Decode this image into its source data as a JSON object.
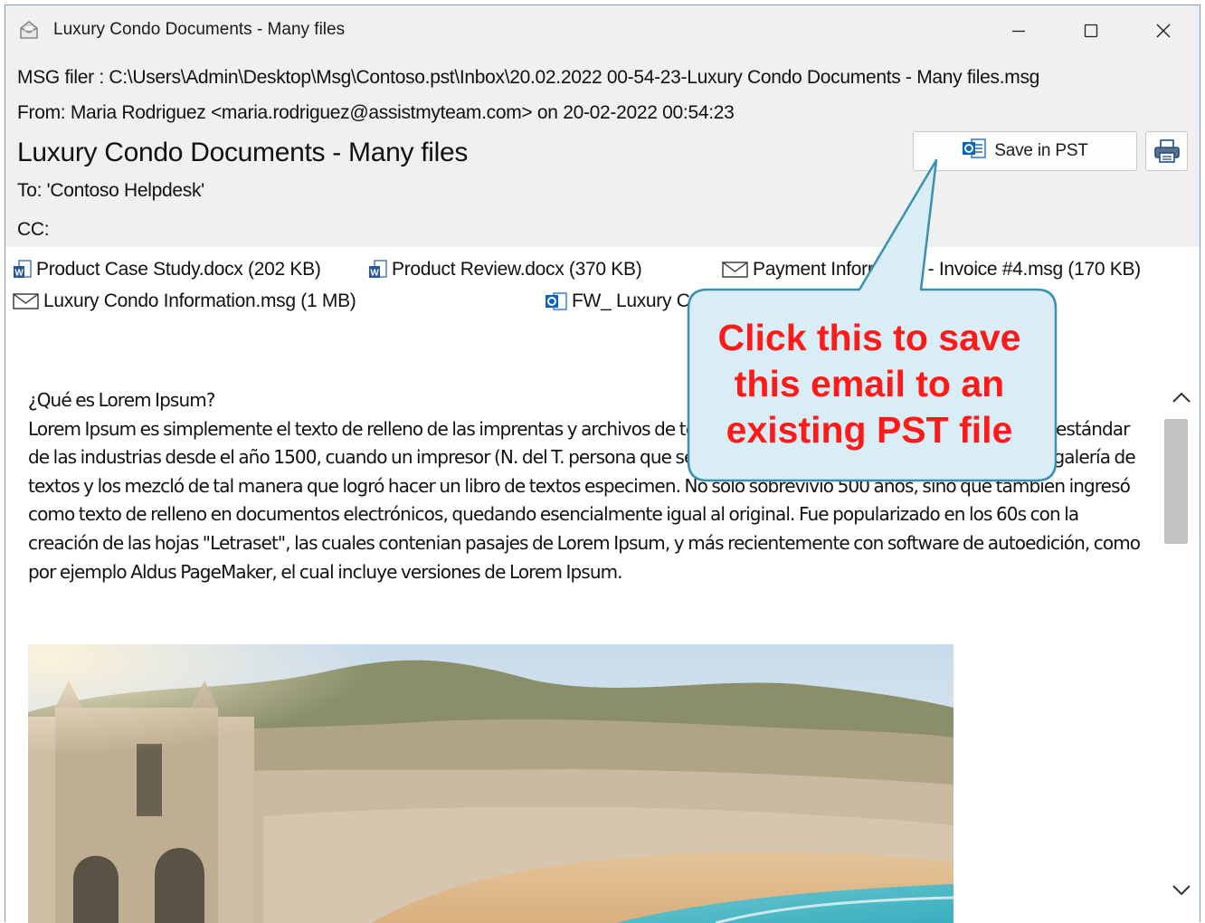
{
  "window": {
    "title": "Luxury Condo Documents - Many files",
    "controls": {
      "minimize": "minimize",
      "maximize": "maximize",
      "close": "close"
    }
  },
  "header": {
    "msg_file": "MSG filer : C:\\Users\\Admin\\Desktop\\Msg\\Contoso.pst\\Inbox\\20.02.2022 00-54-23-Luxury Condo Documents - Many files.msg",
    "from": "From: Maria Rodriguez <maria.rodriguez@assistmyteam.com> on 20-02-2022 00:54:23",
    "subject": "Luxury Condo Documents - Many files",
    "to": "To: 'Contoso Helpdesk'",
    "cc": "CC:"
  },
  "toolbar": {
    "save_label": "Save in PST",
    "print_icon": "printer-icon"
  },
  "attachments": [
    {
      "name": "Product Case Study.docx (202 KB)",
      "icon": "word-doc-icon"
    },
    {
      "name": "Product Review.docx (370 KB)",
      "icon": "word-doc-icon"
    },
    {
      "name": "Payment Information - Invoice #4.msg (170 KB)",
      "icon": "envelope-icon"
    },
    {
      "name": "Luxury Condo Information.msg (1 MB)",
      "icon": "envelope-icon"
    },
    {
      "name": "FW_ Luxury Condo Documents.msg",
      "icon": "outlook-icon"
    }
  ],
  "body": {
    "heading": "¿Qué es Lorem Ipsum?",
    "paragraph": "Lorem Ipsum es simplemente el texto de relleno de las imprentas y archivos de texto. Lorem Ipsum ha sido el texto de relleno estándar de las industrias desde el año 1500, cuando un impresor (N. del T. persona que se dedica a la imprenta) desconocido usó una galería de textos y los mezcló de tal manera que logró hacer un libro de textos especimen. No sólo sobrevivió 500 años, sino que tambien ingresó como texto de relleno en documentos electrónicos, quedando esencialmente igual al original. Fue popularizado en los 60s con la creación de las hojas \"Letraset\", las cuales contenian pasajes de Lorem Ipsum, y más recientemente con software de autoedición, como por ejemplo Aldus PageMaker, el cual incluye versiones de Lorem Ipsum."
  },
  "callout": {
    "text": "Click this to save\nthis email to an\nexisting PST file"
  },
  "colors": {
    "callout_fill": "#d8edf5",
    "callout_border": "#3b8fb1",
    "callout_text": "#ff1a1a"
  }
}
